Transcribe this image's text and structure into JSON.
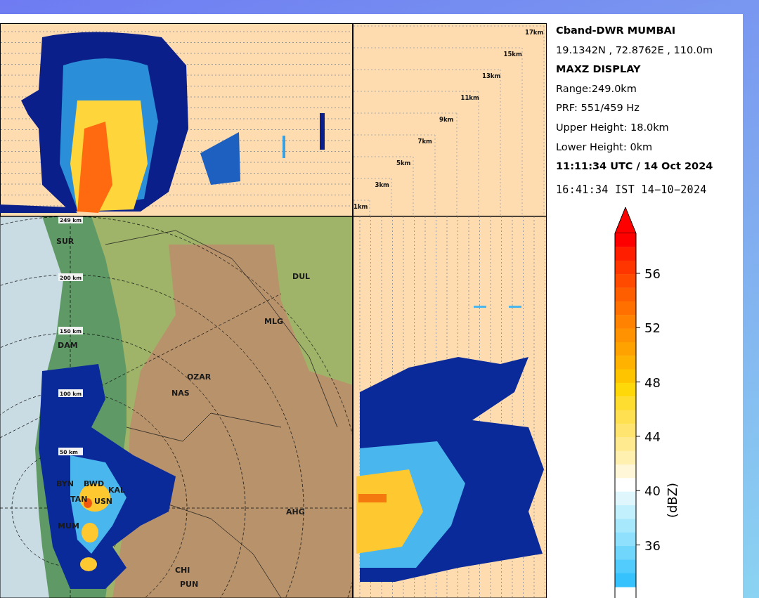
{
  "height_panel": {
    "labels": [
      "1km",
      "3km",
      "5km",
      "7km",
      "9km",
      "11km",
      "13km",
      "15km",
      "17km"
    ]
  },
  "map": {
    "range_labels": [
      "249 km",
      "200 km",
      "150 km",
      "100 km",
      "50 km"
    ],
    "places": [
      "SUR",
      "DUL",
      "MLG",
      "DAM",
      "OZAR",
      "NAS",
      "BYN",
      "BWD",
      "KAL",
      "USN",
      "TAN",
      "MUM",
      "AHG",
      "CHI",
      "PUN"
    ]
  },
  "info": {
    "station": "Cband-DWR MUMBAI",
    "coords": "19.1342N , 72.8762E , 110.0m",
    "product": "MAXZ DISPLAY",
    "lines": [
      "Range:249.0km",
      "PRF: 551/459 Hz",
      "Upper Height: 18.0km",
      "Lower Height: 0km"
    ],
    "time_utc": "11:11:34 UTC / 14 Oct 2024",
    "time_ist": "16:41:34 IST 14−10−2024"
  },
  "colorbar": {
    "ticks": [
      "56",
      "52",
      "48",
      "44",
      "40",
      "36"
    ],
    "unit": "(dBZ)"
  }
}
